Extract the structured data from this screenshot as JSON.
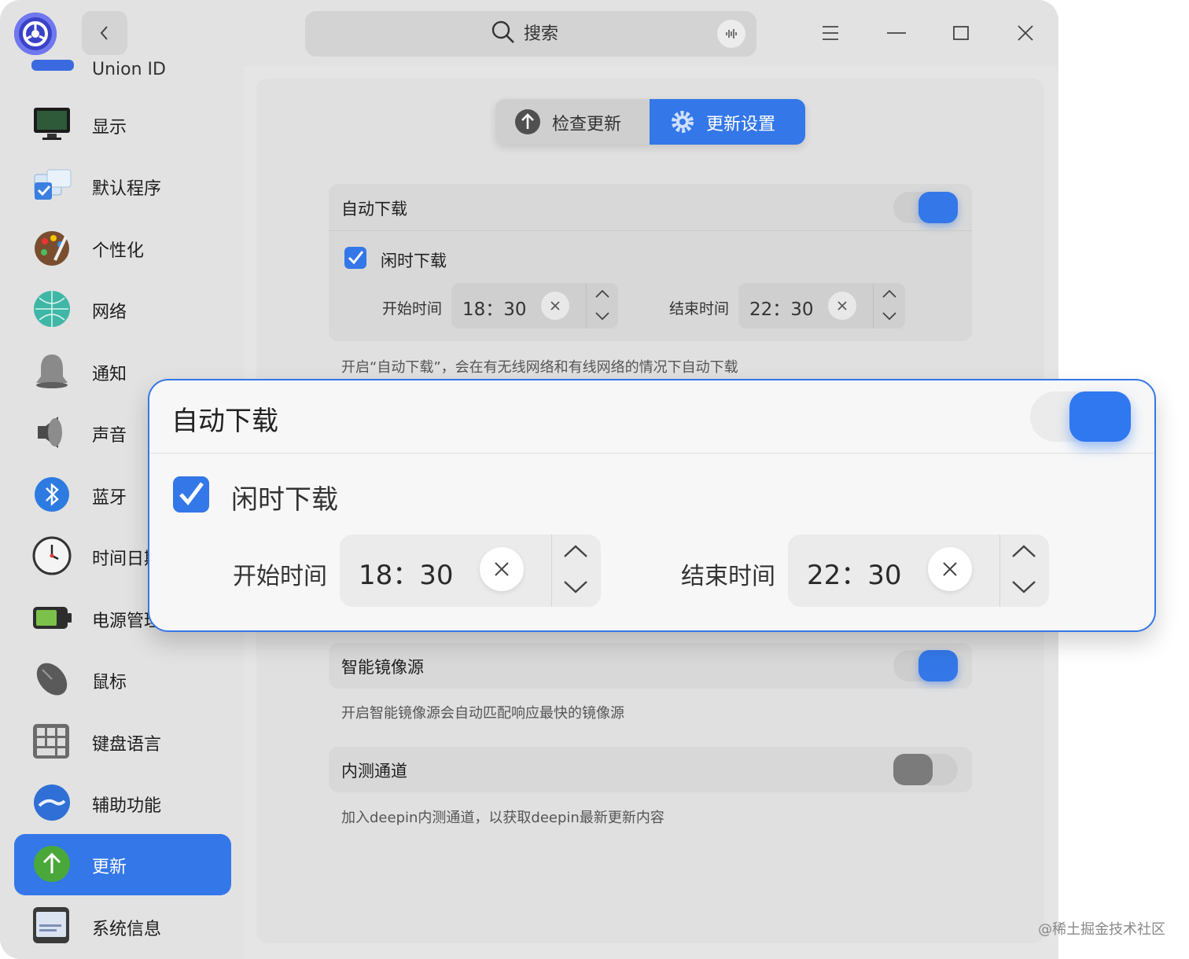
{
  "search": {
    "placeholder": "搜索"
  },
  "sidebar": {
    "items": [
      {
        "label": "Union ID",
        "icon": "union-id-icon"
      },
      {
        "label": "显示",
        "icon": "display-icon"
      },
      {
        "label": "默认程序",
        "icon": "default-apps-icon"
      },
      {
        "label": "个性化",
        "icon": "personalization-icon"
      },
      {
        "label": "网络",
        "icon": "network-icon"
      },
      {
        "label": "通知",
        "icon": "notification-bell-icon"
      },
      {
        "label": "声音",
        "icon": "speaker-icon"
      },
      {
        "label": "蓝牙",
        "icon": "bluetooth-icon"
      },
      {
        "label": "时间日期",
        "icon": "clock-icon"
      },
      {
        "label": "电源管理",
        "icon": "battery-icon"
      },
      {
        "label": "鼠标",
        "icon": "mouse-icon"
      },
      {
        "label": "键盘语言",
        "icon": "keyboard-icon"
      },
      {
        "label": "辅助功能",
        "icon": "accessibility-icon"
      },
      {
        "label": "更新",
        "icon": "update-arrow-icon",
        "active": true
      },
      {
        "label": "系统信息",
        "icon": "system-info-icon"
      }
    ]
  },
  "tabs": {
    "check_update": "检查更新",
    "update_settings": "更新设置"
  },
  "auto_download": {
    "title": "自动下载",
    "enabled": true,
    "idle_label": "闲时下载",
    "idle_checked": true,
    "start_label": "开始时间",
    "start_value": "18：30",
    "end_label": "结束时间",
    "end_value": "22：30",
    "note": "开启“自动下载”，会在有无线网络和有线网络的情况下自动下载"
  },
  "smart_mirror": {
    "title": "智能镜像源",
    "enabled": true,
    "note": "开启智能镜像源会自动匹配响应最快的镜像源"
  },
  "beta": {
    "title": "内测通道",
    "enabled": false,
    "note": "加入deepin内测通道，以获取deepin最新更新内容"
  },
  "colors": {
    "accent": "#3477e8",
    "window_bg": "#e5e5e5"
  },
  "watermark": "@稀土掘金技术社区"
}
